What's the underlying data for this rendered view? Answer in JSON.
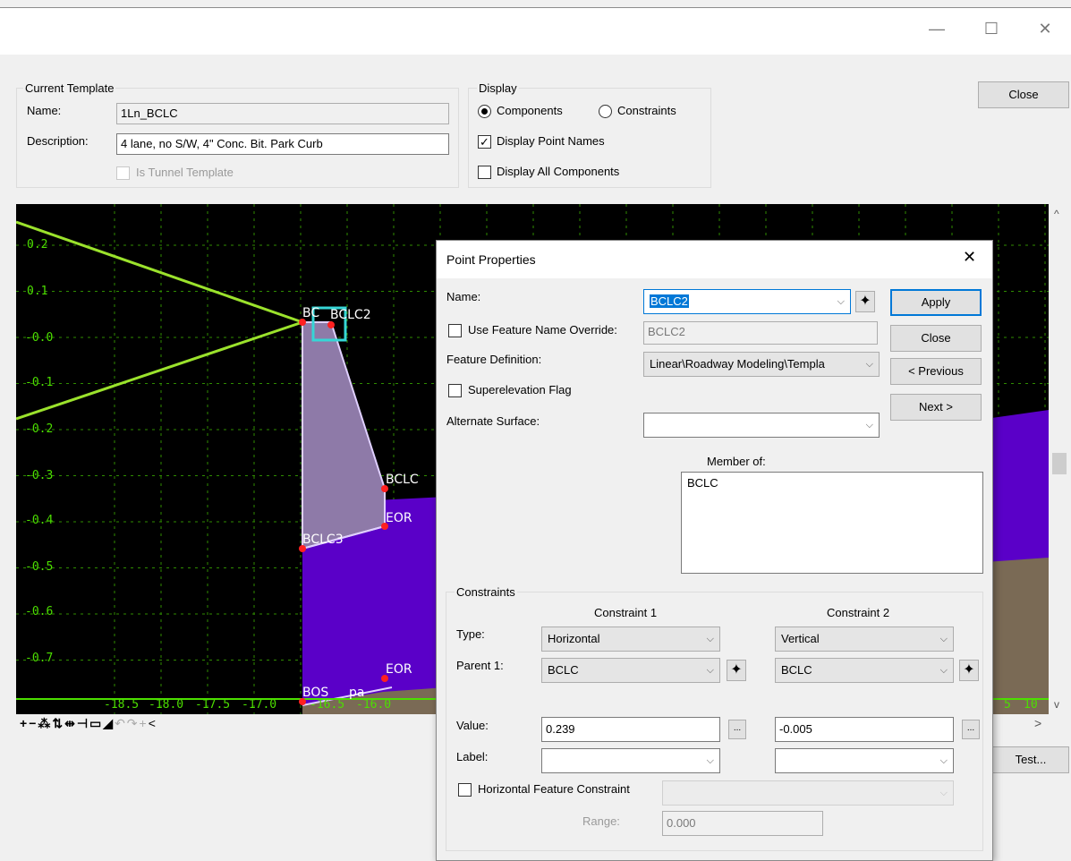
{
  "window": {
    "minimize_glyph": "—",
    "maximize_glyph": "☐",
    "close_glyph": "✕"
  },
  "current_template": {
    "group_label": "Current Template",
    "name_label": "Name:",
    "name_value": "1Ln_BCLC",
    "description_label": "Description:",
    "description_value": "4 lane, no S/W, 4\" Conc. Bit. Park Curb",
    "is_tunnel_label": "Is Tunnel Template"
  },
  "display": {
    "group_label": "Display",
    "components_label": "Components",
    "constraints_label": "Constraints",
    "components_selected": true,
    "display_point_names_label": "Display Point Names",
    "display_point_names_checked": true,
    "display_all_components_label": "Display All Components",
    "display_all_components_checked": false
  },
  "main_buttons": {
    "close": "Close",
    "test": "Test..."
  },
  "canvas": {
    "y_ticks": [
      "0.2",
      "0.1",
      "-0.0",
      "-0.1",
      "-0.2",
      "-0.3",
      "-0.4",
      "-0.5",
      "-0.6",
      "-0.7"
    ],
    "x_ticks": [
      "-18.5",
      "-18.0",
      "-17.5",
      "-17.0",
      "-16.5",
      "-16.0"
    ],
    "x_ticks_right": [
      "5",
      "10"
    ],
    "point_labels": {
      "bc": "BC",
      "bclc2": "BCLC2",
      "bclc": "BCLC",
      "eor": "EOR",
      "bclc3": "BCLC3",
      "eor_bottom": "EOR",
      "bos": "BOS",
      "pa": "pa"
    },
    "colors": {
      "background": "#000000",
      "grid": "#3bb000",
      "line": "#9be22c",
      "curb_fill": "#8e7aa8",
      "purple": "#5a00c8",
      "brown": "#7a6a55"
    }
  },
  "toolbar_icons": [
    "plus-icon",
    "minus-icon",
    "add-point-icon",
    "move-icon",
    "split-icon",
    "node-icon",
    "rectangle-icon",
    "fill-icon",
    "undo-icon",
    "redo-icon",
    "crosshair-icon",
    "chevron-left-icon"
  ],
  "dialog": {
    "title": "Point Properties",
    "name_label": "Name:",
    "name_value": "BCLC2",
    "use_feature_override_label": "Use Feature Name Override:",
    "override_value": "BCLC2",
    "feature_definition_label": "Feature Definition:",
    "feature_definition_value": "Linear\\Roadway Modeling\\Templa",
    "superelevation_label": "Superelevation Flag",
    "alternate_surface_label": "Alternate Surface:",
    "alternate_surface_value": "",
    "member_of_label": "Member of:",
    "member_of_items": [
      "BCLC"
    ],
    "buttons": {
      "apply": "Apply",
      "close": "Close",
      "previous": "< Previous",
      "next": "Next >"
    },
    "constraints": {
      "group_label": "Constraints",
      "type_label": "Type:",
      "parent_label": "Parent 1:",
      "value_label": "Value:",
      "label_label": "Label:",
      "c1": {
        "header": "Constraint 1",
        "type": "Horizontal",
        "parent": "BCLC",
        "value": "0.239",
        "label": ""
      },
      "c2": {
        "header": "Constraint 2",
        "type": "Vertical",
        "parent": "BCLC",
        "value": "-0.005",
        "label": ""
      },
      "dots_label": "...",
      "horizontal_feature_label": "Horizontal Feature Constraint",
      "range_label": "Range:",
      "range_value": "0.000"
    }
  }
}
